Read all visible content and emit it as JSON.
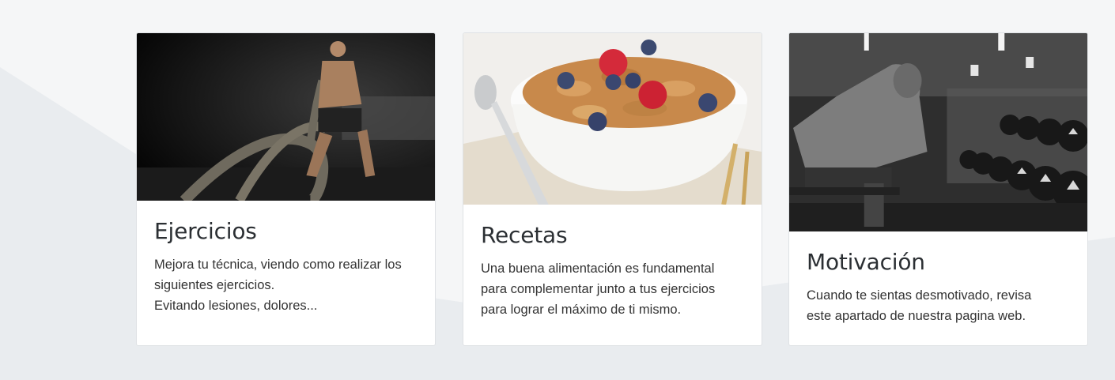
{
  "colors": {
    "page_bg": "#e9ecef",
    "upper_bg": "#f5f6f7",
    "card_bg": "#ffffff",
    "card_border": "#dfe2e5"
  },
  "cards": [
    {
      "image_icon": "battle-ropes-photo",
      "title": "Ejercicios",
      "lines": [
        "Mejora tu técnica, viendo como realizar los",
        "siguientes ejercicios.",
        "Evitando lesiones, dolores..."
      ]
    },
    {
      "image_icon": "cereal-bowl-photo",
      "title": "Recetas",
      "lines": [
        "Una buena alimentación es fundamental",
        "para complementar junto a tus ejercicios",
        "para lograr el máximo de ti mismo."
      ]
    },
    {
      "image_icon": "gym-dumbbells-photo",
      "title": "Motivación",
      "lines": [
        "Cuando te sientas desmotivado, revisa",
        "este apartado de nuestra pagina web."
      ]
    }
  ]
}
